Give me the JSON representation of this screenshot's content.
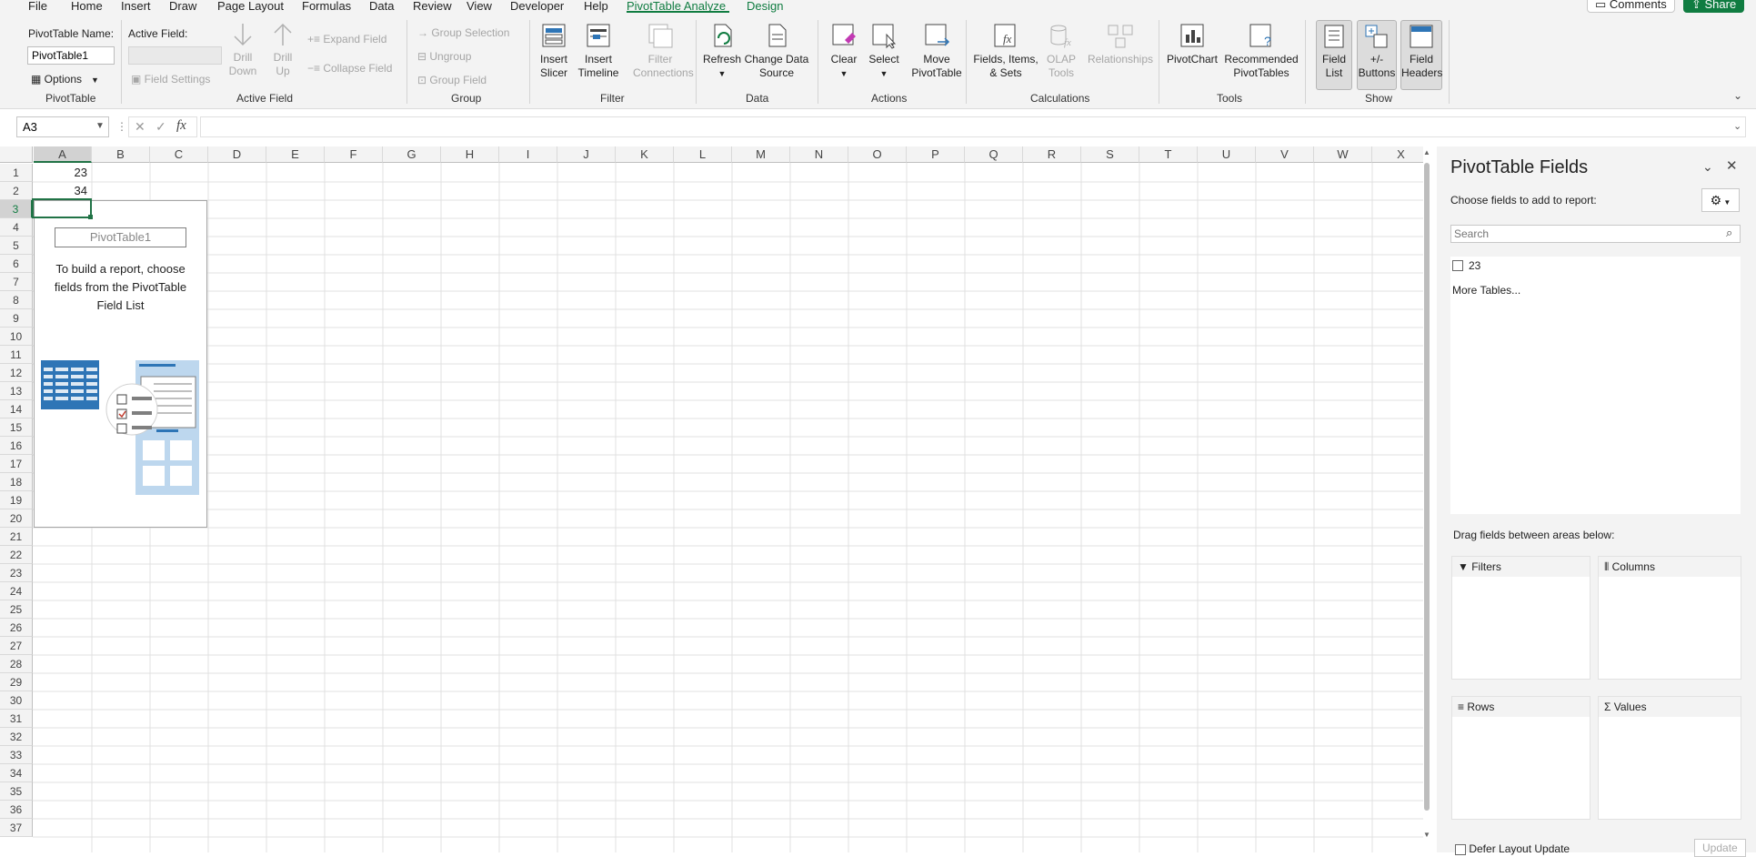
{
  "menu": {
    "items": [
      "File",
      "Home",
      "Insert",
      "Draw",
      "Page Layout",
      "Formulas",
      "Data",
      "Review",
      "View",
      "Developer",
      "Help",
      "PivotTable Analyze",
      "Design"
    ],
    "comments_label": "Comments",
    "share_label": "Share"
  },
  "ribbon": {
    "pivottable": {
      "name_label": "PivotTable Name:",
      "name_value": "PivotTable1",
      "options_label": "Options",
      "group_label": "PivotTable"
    },
    "active_field": {
      "label": "Active Field:",
      "field_settings": "Field Settings",
      "drill_down": "Drill\nDown",
      "drill_up": "Drill\nUp",
      "expand_field": "Expand Field",
      "collapse_field": "Collapse Field",
      "group_label": "Active Field"
    },
    "group": {
      "group_selection": "Group Selection",
      "ungroup": "Ungroup",
      "group_field": "Group Field",
      "group_label": "Group"
    },
    "filter": {
      "insert_slicer": "Insert\nSlicer",
      "insert_timeline": "Insert\nTimeline",
      "filter_connections": "Filter\nConnections",
      "group_label": "Filter"
    },
    "data": {
      "refresh": "Refresh",
      "change_data_source": "Change Data\nSource",
      "group_label": "Data"
    },
    "actions": {
      "clear": "Clear",
      "select": "Select",
      "move_pivottable": "Move\nPivotTable",
      "group_label": "Actions"
    },
    "calculations": {
      "fields_items_sets": "Fields, Items,\n& Sets",
      "olap_tools": "OLAP\nTools",
      "relationships": "Relationships",
      "group_label": "Calculations"
    },
    "tools": {
      "pivotchart": "PivotChart",
      "recommended": "Recommended\nPivotTables",
      "group_label": "Tools"
    },
    "show": {
      "field_list": "Field\nList",
      "buttons": "+/-\nButtons",
      "field_headers": "Field\nHeaders",
      "group_label": "Show"
    }
  },
  "formula_bar": {
    "name_box": "A3",
    "formula": ""
  },
  "grid": {
    "columns": [
      "A",
      "B",
      "C",
      "D",
      "E",
      "F",
      "G",
      "H",
      "I",
      "J",
      "K",
      "L",
      "M",
      "N",
      "O",
      "P",
      "Q",
      "R",
      "S",
      "T",
      "U",
      "V",
      "W",
      "X"
    ],
    "rows": [
      "1",
      "2",
      "3",
      "4",
      "5",
      "6",
      "7",
      "8",
      "9",
      "10",
      "11",
      "12",
      "13",
      "14",
      "15",
      "16",
      "17",
      "18",
      "19",
      "20",
      "21",
      "22",
      "23",
      "24",
      "25",
      "26",
      "27",
      "28",
      "29",
      "30",
      "31",
      "32",
      "33",
      "34",
      "35",
      "36",
      "37"
    ],
    "cells": {
      "A1": "23",
      "A2": "34"
    },
    "selected_cell": "A3"
  },
  "pivot_placeholder": {
    "name": "PivotTable1",
    "message": "To build a report, choose fields from the PivotTable Field List"
  },
  "pane": {
    "title": "PivotTable Fields",
    "choose_label": "Choose fields to add to report:",
    "search_placeholder": "Search",
    "fields": [
      "23"
    ],
    "more_tables": "More Tables...",
    "drag_label": "Drag fields between areas below:",
    "areas": {
      "filters": "Filters",
      "columns": "Columns",
      "rows": "Rows",
      "values": "Values"
    },
    "defer_label": "Defer Layout Update",
    "update_label": "Update"
  },
  "colors": {
    "accent_green": "#107c41",
    "selection_border": "#217346"
  }
}
